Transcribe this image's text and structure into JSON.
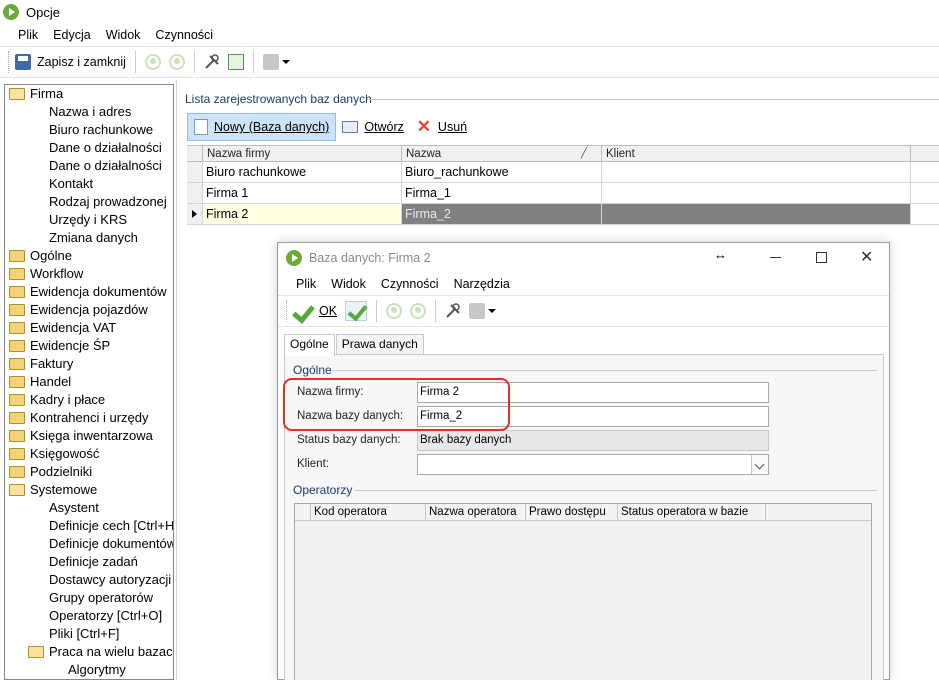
{
  "window": {
    "title": "Opcje"
  },
  "menu": {
    "items": [
      "Plik",
      "Edycja",
      "Widok",
      "Czynności"
    ]
  },
  "toolbar": {
    "save_label": "Zapisz i zamknij"
  },
  "tree": {
    "items": [
      {
        "label": "Firma",
        "level": 0,
        "folder": "open"
      },
      {
        "label": "Nazwa i adres",
        "level": 1
      },
      {
        "label": "Biuro rachunkowe",
        "level": 1
      },
      {
        "label": "Dane o działalności",
        "level": 1
      },
      {
        "label": "Dane o działalności",
        "level": 1
      },
      {
        "label": "Kontakt",
        "level": 1
      },
      {
        "label": "Rodzaj prowadzonej",
        "level": 1
      },
      {
        "label": "Urzędy i KRS",
        "level": 1
      },
      {
        "label": "Zmiana danych",
        "level": 1
      },
      {
        "label": "Ogólne",
        "level": 0,
        "folder": "closed"
      },
      {
        "label": "Workflow",
        "level": 0,
        "folder": "closed"
      },
      {
        "label": "Ewidencja dokumentów",
        "level": 0,
        "folder": "closed"
      },
      {
        "label": "Ewidencja pojazdów",
        "level": 0,
        "folder": "closed"
      },
      {
        "label": "Ewidencja VAT",
        "level": 0,
        "folder": "closed"
      },
      {
        "label": "Ewidencje ŚP",
        "level": 0,
        "folder": "closed"
      },
      {
        "label": "Faktury",
        "level": 0,
        "folder": "closed"
      },
      {
        "label": "Handel",
        "level": 0,
        "folder": "closed"
      },
      {
        "label": "Kadry i płace",
        "level": 0,
        "folder": "closed"
      },
      {
        "label": "Kontrahenci i urzędy",
        "level": 0,
        "folder": "closed"
      },
      {
        "label": "Księga inwentarzowa",
        "level": 0,
        "folder": "closed"
      },
      {
        "label": "Księgowość",
        "level": 0,
        "folder": "closed"
      },
      {
        "label": "Podzielniki",
        "level": 0,
        "folder": "closed"
      },
      {
        "label": "Systemowe",
        "level": 0,
        "folder": "open"
      },
      {
        "label": "Asystent",
        "level": 1
      },
      {
        "label": "Definicje cech [Ctrl+H",
        "level": 1
      },
      {
        "label": "Definicje dokumentów",
        "level": 1
      },
      {
        "label": "Definicje zadań",
        "level": 1
      },
      {
        "label": "Dostawcy autoryzacji",
        "level": 1
      },
      {
        "label": "Grupy operatorów",
        "level": 1
      },
      {
        "label": "Operatorzy [Ctrl+O]",
        "level": 1
      },
      {
        "label": "Pliki [Ctrl+F]",
        "level": 1
      },
      {
        "label": "Praca na wielu bazach",
        "level": 1,
        "folder": "open"
      },
      {
        "label": "Algorytmy",
        "level": 2
      }
    ]
  },
  "panel": {
    "title": "Lista zarejestrowanych baz danych",
    "new_label": "Nowy (Baza danych)",
    "open_label": "Otwórz",
    "delete_label": "Usuń",
    "columns": [
      "Nazwa firmy",
      "Nazwa",
      "Klient"
    ],
    "rows": [
      [
        "Biuro rachunkowe",
        "Biuro_rachunkowe",
        ""
      ],
      [
        "Firma 1",
        "Firma_1",
        ""
      ],
      [
        "Firma 2",
        "Firma_2",
        ""
      ]
    ],
    "selected_row": 2
  },
  "dialog": {
    "title": "Baza danych: Firma 2",
    "menu": [
      "Plik",
      "Widok",
      "Czynności",
      "Narzędzia"
    ],
    "ok_label": "OK",
    "tabs": [
      "Ogólne",
      "Prawa danych"
    ],
    "active_tab": "Ogólne",
    "section_general": "Ogólne",
    "fields": {
      "company_label": "Nazwa firmy:",
      "company_value": "Firma 2",
      "dbname_label": "Nazwa bazy danych:",
      "dbname_value": "Firma_2",
      "status_label": "Status bazy danych:",
      "status_value": "Brak bazy danych",
      "client_label": "Klient:",
      "client_value": ""
    },
    "section_operators": "Operatorzy",
    "operator_columns": [
      "Kod operatora",
      "Nazwa operatora",
      "Prawo dostępu",
      "Status operatora w bazie"
    ]
  }
}
